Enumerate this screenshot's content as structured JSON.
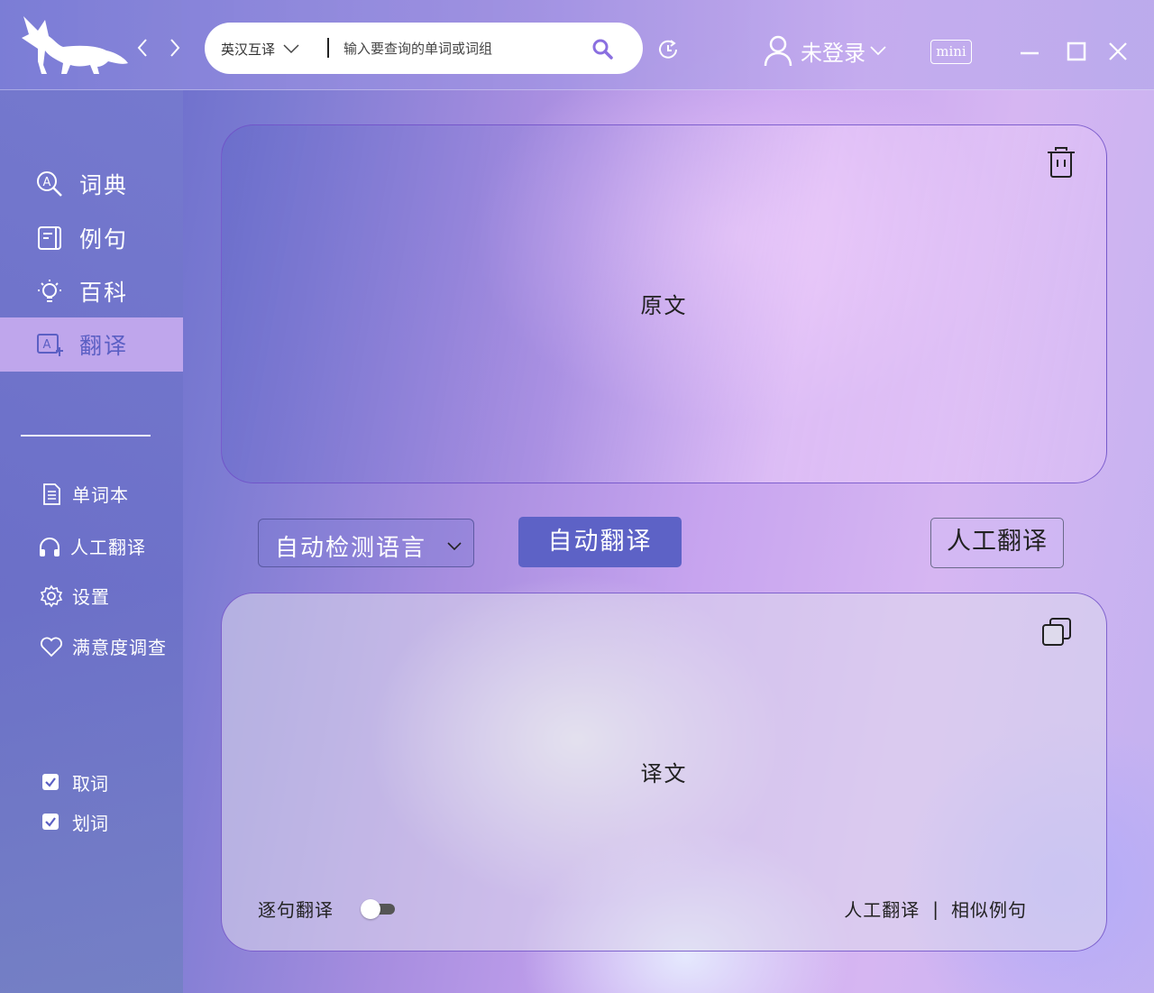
{
  "header": {
    "search": {
      "lang_select": "英汉互译",
      "placeholder": "输入要查询的单词或词组",
      "value": ""
    },
    "user": {
      "name": "未登录"
    },
    "mini_label": "mini",
    "icons": [
      "fox-logo",
      "back-arrow-icon",
      "forward-arrow-icon",
      "search-icon",
      "history-icon",
      "user-icon",
      "minimize-icon",
      "maximize-icon",
      "close-icon"
    ]
  },
  "sidebar": {
    "items": [
      {
        "label": "词典",
        "icon": "dictionary-search-icon",
        "active": false
      },
      {
        "label": "例句",
        "icon": "example-book-icon",
        "active": false
      },
      {
        "label": "百科",
        "icon": "lightbulb-icon",
        "active": false
      },
      {
        "label": "翻译",
        "icon": "translate-icon",
        "active": true
      }
    ],
    "sub_items": [
      {
        "label": "单词本",
        "icon": "document-icon"
      },
      {
        "label": "人工翻译",
        "icon": "headphones-icon"
      },
      {
        "label": "设置",
        "icon": "gear-icon"
      },
      {
        "label": "满意度调查",
        "icon": "heart-icon"
      }
    ],
    "checks": [
      {
        "label": "取词",
        "checked": true
      },
      {
        "label": "划词",
        "checked": true
      }
    ]
  },
  "main": {
    "source": {
      "placeholder": "原文"
    },
    "controls": {
      "lang_detect": "自动检测语言",
      "auto_translate": "自动翻译",
      "human_translate": "人工翻译"
    },
    "target": {
      "placeholder": "译文",
      "sentence_mode_label": "逐句翻译",
      "sentence_mode_on": false,
      "links": [
        "人工翻译",
        "相似例句"
      ],
      "separator": "|"
    }
  },
  "colors": {
    "accent": "#5d62c6",
    "active_sidebar_bg": "#bfa6ec",
    "panel_border": "#7050c8"
  }
}
